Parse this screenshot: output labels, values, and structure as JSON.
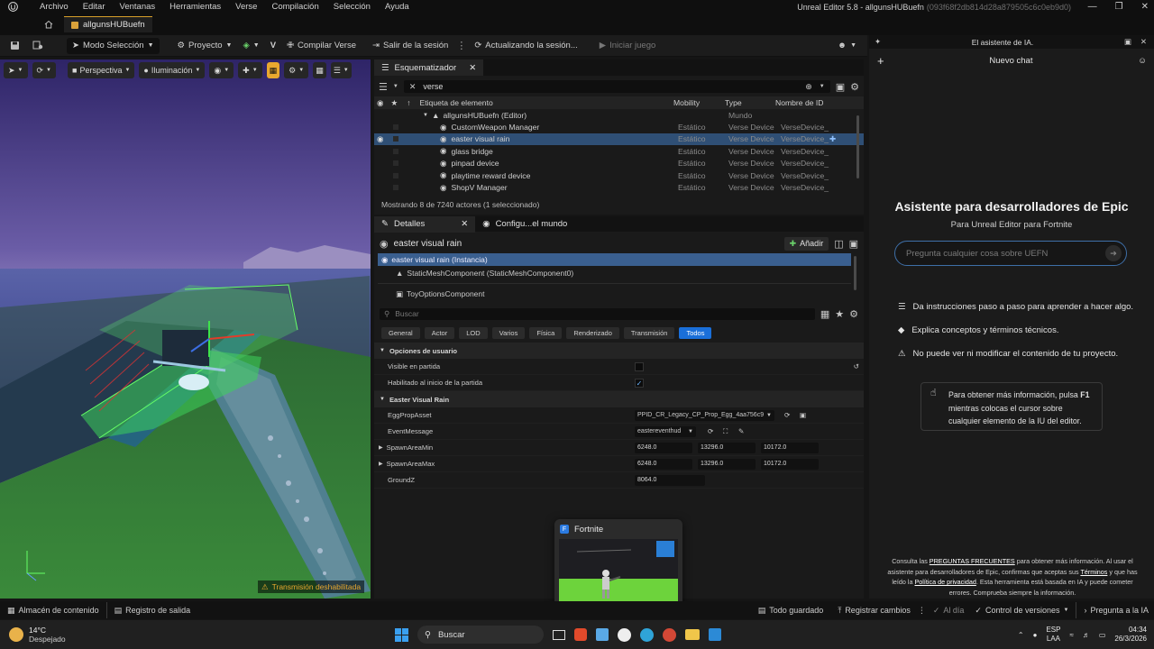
{
  "window": {
    "menu": [
      "Archivo",
      "Editar",
      "Ventanas",
      "Herramientas",
      "Verse",
      "Compilación",
      "Selección",
      "Ayuda"
    ],
    "title": "Unreal Editor 5.8 - allgunsHUBuefn",
    "title_hash": "(093f68f2db814d28a879505c6c0eb9d0)",
    "tab": "allgunsHUBuefn"
  },
  "toolbar": {
    "mode": "Modo Selección",
    "project": "Proyecto",
    "compile": "Compilar Verse",
    "logout": "Salir de la sesión",
    "updating": "Actualizando la sesión...",
    "start": "Iniciar juego"
  },
  "viewport": {
    "perspective": "Perspectiva",
    "lighting": "Iluminación",
    "warning": "Transmisión deshabilitada",
    "accent": "#e9a82f"
  },
  "outliner": {
    "tab": "Esquematizador",
    "search": "verse",
    "headers": {
      "label": "Etiqueta de elemento",
      "mobility": "Mobility",
      "type": "Type",
      "id": "Nombre de ID"
    },
    "root": {
      "label": "allgunsHUBuefn (Editor)",
      "type": "Mundo"
    },
    "rows": [
      {
        "label": "CustomWeapon Manager",
        "mobility": "Estático",
        "type": "Verse Device",
        "id": "VerseDevice_",
        "selected": false
      },
      {
        "label": "easter visual rain",
        "mobility": "Estático",
        "type": "Verse Device",
        "id": "VerseDevice_",
        "selected": true
      },
      {
        "label": "glass bridge",
        "mobility": "Estático",
        "type": "Verse Device",
        "id": "VerseDevice_",
        "selected": false
      },
      {
        "label": "pinpad device",
        "mobility": "Estático",
        "type": "Verse Device",
        "id": "VerseDevice_",
        "selected": false
      },
      {
        "label": "playtime reward device",
        "mobility": "Estático",
        "type": "Verse Device",
        "id": "VerseDevice_",
        "selected": false
      },
      {
        "label": "ShopV Manager",
        "mobility": "Estático",
        "type": "Verse Device",
        "id": "VerseDevice_",
        "selected": false
      }
    ],
    "footer": "Mostrando 8 de 7240 actores (1 seleccionado)"
  },
  "details": {
    "tab1": "Detalles",
    "tab2": "Configu...el mundo",
    "actor": "easter visual rain",
    "add": "Añadir",
    "components": [
      "easter visual rain (Instancia)",
      "StaticMeshComponent (StaticMeshComponent0)",
      "ToyOptionsComponent"
    ],
    "search": "Buscar",
    "filters": [
      "General",
      "Actor",
      "LOD",
      "Varios",
      "Física",
      "Renderizado",
      "Transmisión",
      "Todos"
    ],
    "cat1": "Opciones de usuario",
    "visible": "Visible en partida",
    "enabled": "Habilitado al inicio de la partida",
    "cat2": "Easter Visual Rain",
    "egg_label": "EggPropAsset",
    "egg_value": "PPID_CR_Legacy_CP_Prop_Egg_4aa756c9",
    "event_label": "EventMessage",
    "event_value": "eastereventhud",
    "min_label": "SpawnAreaMin",
    "min": [
      "6248.0",
      "13296.0",
      "10172.0"
    ],
    "max_label": "SpawnAreaMax",
    "max": [
      "6248.0",
      "13296.0",
      "10172.0"
    ],
    "ground_label": "GroundZ",
    "ground": "8064.0"
  },
  "preview": {
    "title": "Fortnite"
  },
  "ai": {
    "header": "El asistente de IA.",
    "newchat": "Nuevo chat",
    "title": "Asistente para desarrolladores de Epic",
    "subtitle": "Para Unreal Editor para Fortnite",
    "placeholder": "Pregunta cualquier cosa sobre UEFN",
    "features": [
      "Da instrucciones paso a paso para aprender a hacer algo.",
      "Explica conceptos y términos técnicos.",
      "No puede ver ni modificar el contenido de tu proyecto."
    ],
    "tip_a": "Para obtener más información, pulsa ",
    "tip_key": "F1",
    "tip_b": " mientras colocas el cursor sobre cualquier elemento de la IU del editor.",
    "legal_1": "Consulta las ",
    "legal_faq": "PREGUNTAS FRECUENTES",
    "legal_2": " para obtener más información. Al usar el asistente para desarrolladores de Epic, confirmas que aceptas sus ",
    "legal_terms": "Términos",
    "legal_3": " y que has leído la ",
    "legal_privacy": "Política de privacidad",
    "legal_4": ". Esta herramienta está basada en IA y puede cometer errores. Comprueba siempre la información."
  },
  "status": {
    "content": "Almacén de contenido",
    "log": "Registro de salida",
    "saved": "Todo guardado",
    "changes": "Registrar cambios",
    "sync": "Al día",
    "vc": "Control de versiones",
    "ask": "Pregunta a la IA"
  },
  "taskbar": {
    "temp": "14°C",
    "weather": "Despejado",
    "search": "Buscar",
    "lang1": "ESP",
    "lang2": "LAA",
    "time": "04:34",
    "date": "26/3/2026"
  }
}
